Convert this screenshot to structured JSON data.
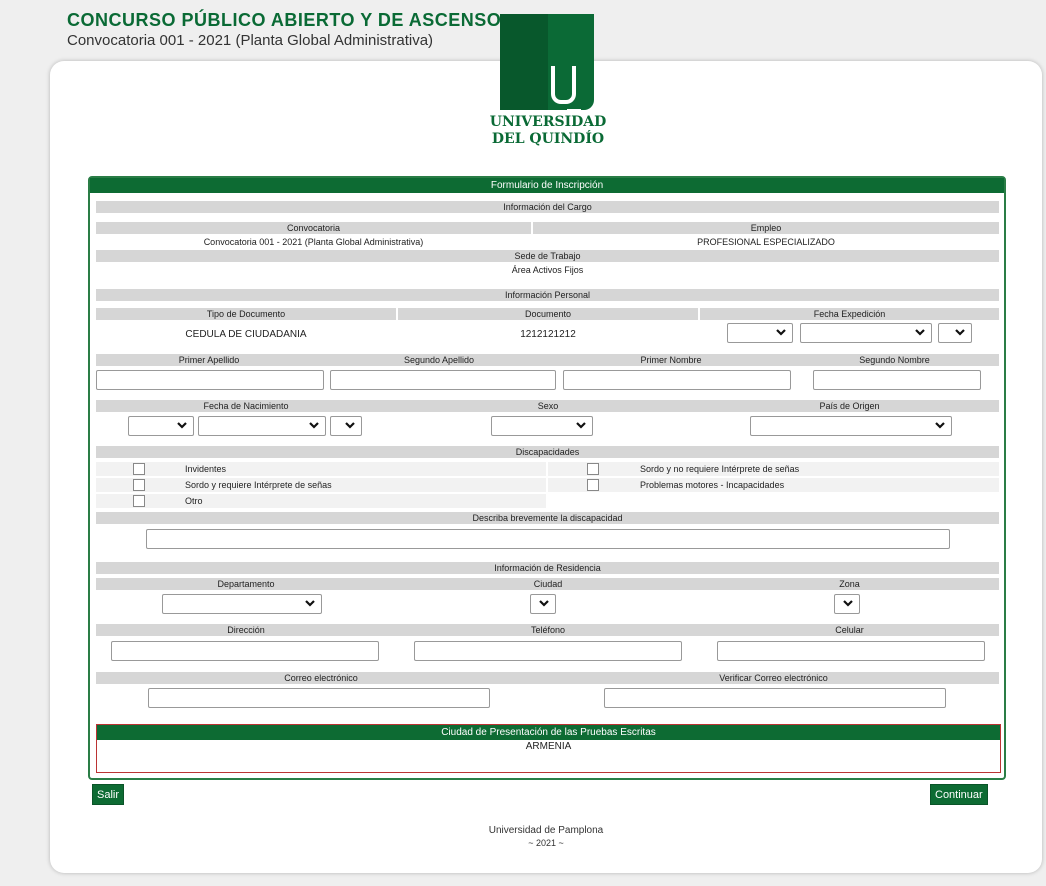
{
  "header": {
    "title": "CONCURSO PÚBLICO ABIERTO Y DE ASCENSO",
    "subtitle": "Convocatoria 001 - 2021 (Planta Global Administrativa)"
  },
  "logo": {
    "line1": "UNIVERSIDAD",
    "line2": "DEL QUINDÍO"
  },
  "form": {
    "title": "Formulario de Inscripción",
    "cargo": {
      "section": "Información del Cargo",
      "convocatoria_label": "Convocatoria",
      "convocatoria_value": "Convocatoria 001 - 2021 (Planta Global Administrativa)",
      "empleo_label": "Empleo",
      "empleo_value": "PROFESIONAL ESPECIALIZADO",
      "sede_label": "Sede de Trabajo",
      "sede_value": "Área Activos Fijos"
    },
    "personal": {
      "section": "Información Personal",
      "tipo_doc_label": "Tipo de Documento",
      "tipo_doc_value": "CEDULA DE CIUDADANIA",
      "documento_label": "Documento",
      "documento_value": "1212121212",
      "fecha_exp_label": "Fecha Expedición",
      "primer_apellido_label": "Primer Apellido",
      "segundo_apellido_label": "Segundo Apellido",
      "primer_nombre_label": "Primer Nombre",
      "segundo_nombre_label": "Segundo Nombre",
      "fecha_nac_label": "Fecha de Nacimiento",
      "sexo_label": "Sexo",
      "pais_label": "País de Origen"
    },
    "discapacidades": {
      "section": "Discapacidades",
      "options": [
        "Invidentes",
        "Sordo y no requiere Intérprete de señas",
        "Sordo y requiere Intérprete de señas",
        "Problemas motores - Incapacidades",
        "Otro"
      ],
      "describe_label": "Describa brevemente la discapacidad"
    },
    "residencia": {
      "section": "Información de Residencia",
      "departamento_label": "Departamento",
      "ciudad_label": "Ciudad",
      "zona_label": "Zona",
      "direccion_label": "Dirección",
      "telefono_label": "Teléfono",
      "celular_label": "Celular",
      "correo_label": "Correo electrónico",
      "verificar_label": "Verificar Correo electrónico"
    },
    "ciudad_pruebas": {
      "title": "Ciudad de Presentación de las Pruebas Escritas",
      "value": "ARMENIA"
    }
  },
  "buttons": {
    "salir": "Salir",
    "continuar": "Continuar"
  },
  "footer": {
    "line1": "Universidad de Pamplona",
    "line2": "~ 2021 ~"
  },
  "colors": {
    "brand_green": "#0d6b33",
    "section_gray": "#d6d6d6",
    "alert_red": "#b33"
  }
}
